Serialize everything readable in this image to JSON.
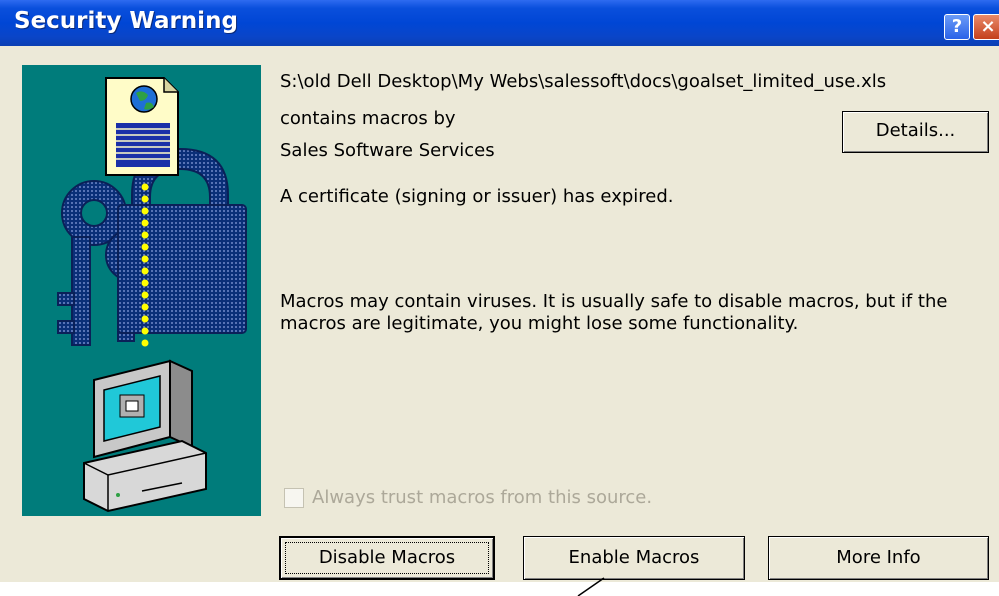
{
  "window": {
    "title": "Security Warning",
    "help_glyph": "?",
    "close_glyph": "×"
  },
  "file_path": "S:\\old Dell Desktop\\My Webs\\salessoft\\docs\\goalset_limited_use.xls",
  "macros_by_line": "contains macros by",
  "publisher": "Sales Software Services",
  "certificate_message": "A certificate (signing or issuer) has expired.",
  "virus_warning": "Macros may contain viruses. It is usually safe to disable macros, but if the macros are legitimate, you might lose some functionality.",
  "checkbox": {
    "label": "Always trust macros from this source.",
    "checked": false,
    "enabled": false
  },
  "buttons": {
    "details": "Details...",
    "disable": "Disable Macros",
    "enable": "Enable Macros",
    "more_info": "More Info"
  },
  "colors": {
    "titlebar": "#0a4fdc",
    "dialog_bg": "#ece9d8",
    "illustration_bg": "#007c7b"
  }
}
